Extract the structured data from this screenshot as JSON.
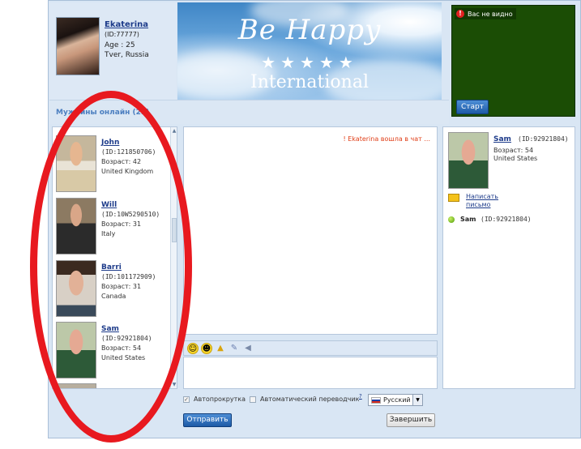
{
  "profile": {
    "name": "Ekaterina",
    "id": "(ID:77777)",
    "age": "Age : 25",
    "city": "Tver, Russia"
  },
  "banner": {
    "line1": "Be Happy",
    "stars": "★★★★★",
    "line2": "International"
  },
  "video": {
    "notice": "Вас не видно",
    "start_label": "Старт"
  },
  "online_bar": {
    "title": "Мужчины онлайн (29)"
  },
  "users": [
    {
      "name": "John",
      "id": "(ID:121850706)",
      "age": "Возраст: 42",
      "country": "United Kingdom"
    },
    {
      "name": "Will",
      "id": "(ID:10W5290510)",
      "age": "Возраст: 31",
      "country": "Italy"
    },
    {
      "name": "Barri",
      "id": "(ID:101172909)",
      "age": "Возраст: 31",
      "country": "Canada"
    },
    {
      "name": "Sam",
      "id": "(ID:92921804)",
      "age": "Возраст: 54",
      "country": "United States"
    }
  ],
  "chat": {
    "system_message": "! Ekaterina вошла в чат ..."
  },
  "options": {
    "autoscroll_label": "Автопрокрутка",
    "autoscroll_checked": true,
    "translate_label": "Автоматический переводчик",
    "translate_checked": false,
    "help_mark": "?",
    "language": "Русский"
  },
  "buttons": {
    "send": "Отправить",
    "finish": "Завершить"
  },
  "selected_user": {
    "name": "Sam",
    "id": "(ID:92921804)",
    "age": "Возраст: 54",
    "country": "United States",
    "write_line1": "Написать",
    "write_line2": "письмо",
    "online_name": "Sam",
    "online_id": "(ID:92921804)"
  },
  "icons": {
    "emoticons": [
      "smile-icon",
      "wink-icon",
      "bell-icon",
      "pen-icon",
      "speaker-icon"
    ]
  },
  "colors": {
    "link": "#1d3b8a",
    "system_message": "#e0401a",
    "annotation": "#e8191f",
    "video_bg": "#1b4d05"
  }
}
